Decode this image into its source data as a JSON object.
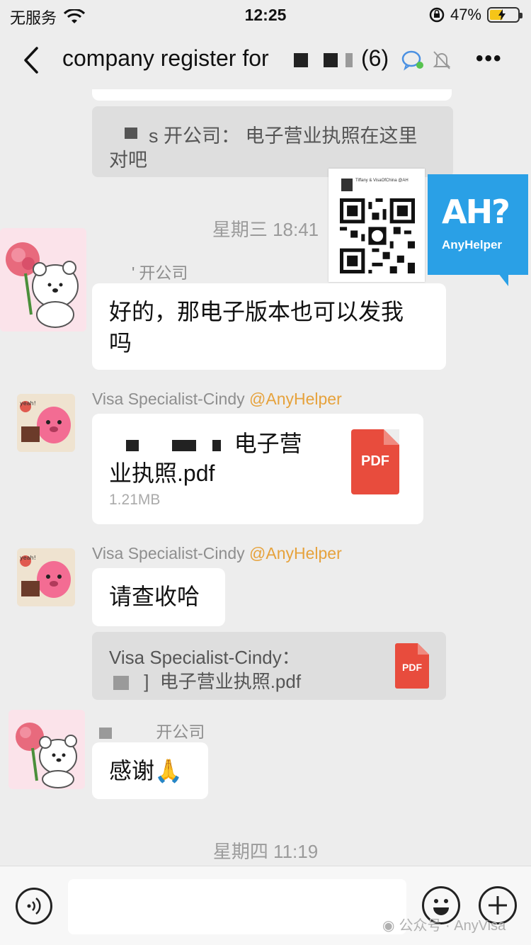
{
  "status_bar": {
    "carrier": "无服务",
    "time": "12:25",
    "battery": "47%",
    "battery_level": 0.47
  },
  "header": {
    "title": "company register for",
    "member_count": "(6)"
  },
  "messages": {
    "quote_top_sender": "s 开公司：",
    "quote_top_line1": "电子营业执照在这里",
    "quote_top_line2": "对吧",
    "time1": "星期三 18:41",
    "sender1": "开公司",
    "msg1_line1": "好的，那电子版本也可以发我",
    "msg1_line2": "吗",
    "sender2_name": "Visa Specialist-Cindy",
    "sender2_tag": "@AnyHelper",
    "file_name_line1": "电子营",
    "file_name_line2": "业执照.pdf",
    "file_size": "1.21MB",
    "file_icon_label": "PDF",
    "sender3_name": "Visa Specialist-Cindy",
    "sender3_tag": "@AnyHelper",
    "msg3": "请查收哈",
    "quote2_sender": "Visa Specialist-Cindy：",
    "quote2_file": "电子营业执照.pdf",
    "quote2_icon_label": "PDF",
    "sender4": "开公司",
    "msg4": "感谢",
    "msg4_emoji": "🙏",
    "time2": "星期四 11:19"
  },
  "overlay": {
    "logo_big": "AH?",
    "logo_small": "AnyHelper",
    "qr_caption": "Tiffany & VisaOfChina @AH"
  },
  "watermark": "公众号 · AnyVisa",
  "colors": {
    "background": "#ededed",
    "bubble": "#ffffff",
    "accent_tag": "#e6a23c",
    "pdf_red": "#e84c3d",
    "logo_blue": "#2aa0e6"
  }
}
